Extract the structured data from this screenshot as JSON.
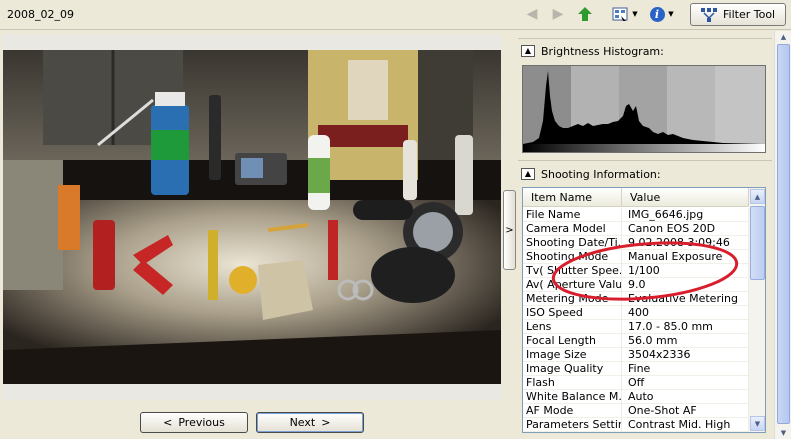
{
  "toolbar": {
    "folder_title": "2008_02_09",
    "filter_label": "Filter Tool",
    "icons": {
      "back": "arrow-left-icon",
      "forward": "arrow-right-icon",
      "up": "arrow-up-icon",
      "view": "view-mode-icon",
      "info": "info-icon",
      "filter": "filter-icon"
    }
  },
  "viewer": {
    "previous_label": "Previous",
    "next_label": "Next"
  },
  "panel": {
    "histogram_title": "Brightness Histogram:",
    "shooting_title": "Shooting Information:",
    "columns": {
      "name": "Item Name",
      "value": "Value"
    },
    "rows": [
      {
        "name": "File Name",
        "value": "IMG_6646.jpg"
      },
      {
        "name": "Camera Model",
        "value": "Canon EOS 20D"
      },
      {
        "name": "Shooting Date/Ti...",
        "value": "9.02.2008 3:09:46"
      },
      {
        "name": "Shooting Mode",
        "value": "Manual Exposure"
      },
      {
        "name": "Tv( Shutter Spee...",
        "value": "1/100"
      },
      {
        "name": "Av( Aperture Valu...",
        "value": "9.0"
      },
      {
        "name": "Metering Mode",
        "value": "Evaluative Metering"
      },
      {
        "name": "ISO Speed",
        "value": "400"
      },
      {
        "name": "Lens",
        "value": "17.0 - 85.0 mm"
      },
      {
        "name": "Focal Length",
        "value": "56.0 mm"
      },
      {
        "name": "Image Size",
        "value": "3504x2336"
      },
      {
        "name": "Image Quality",
        "value": "Fine"
      },
      {
        "name": "Flash",
        "value": "Off"
      },
      {
        "name": "White Balance M...",
        "value": "Auto"
      },
      {
        "name": "AF Mode",
        "value": "One-Shot AF"
      },
      {
        "name": "Parameters Settin...",
        "value": "Contrast  Mid. High"
      }
    ]
  },
  "colors": {
    "annotation": "#d81e2c",
    "window_bg": "#ece9d8",
    "up_arrow": "#2f9a2f"
  }
}
